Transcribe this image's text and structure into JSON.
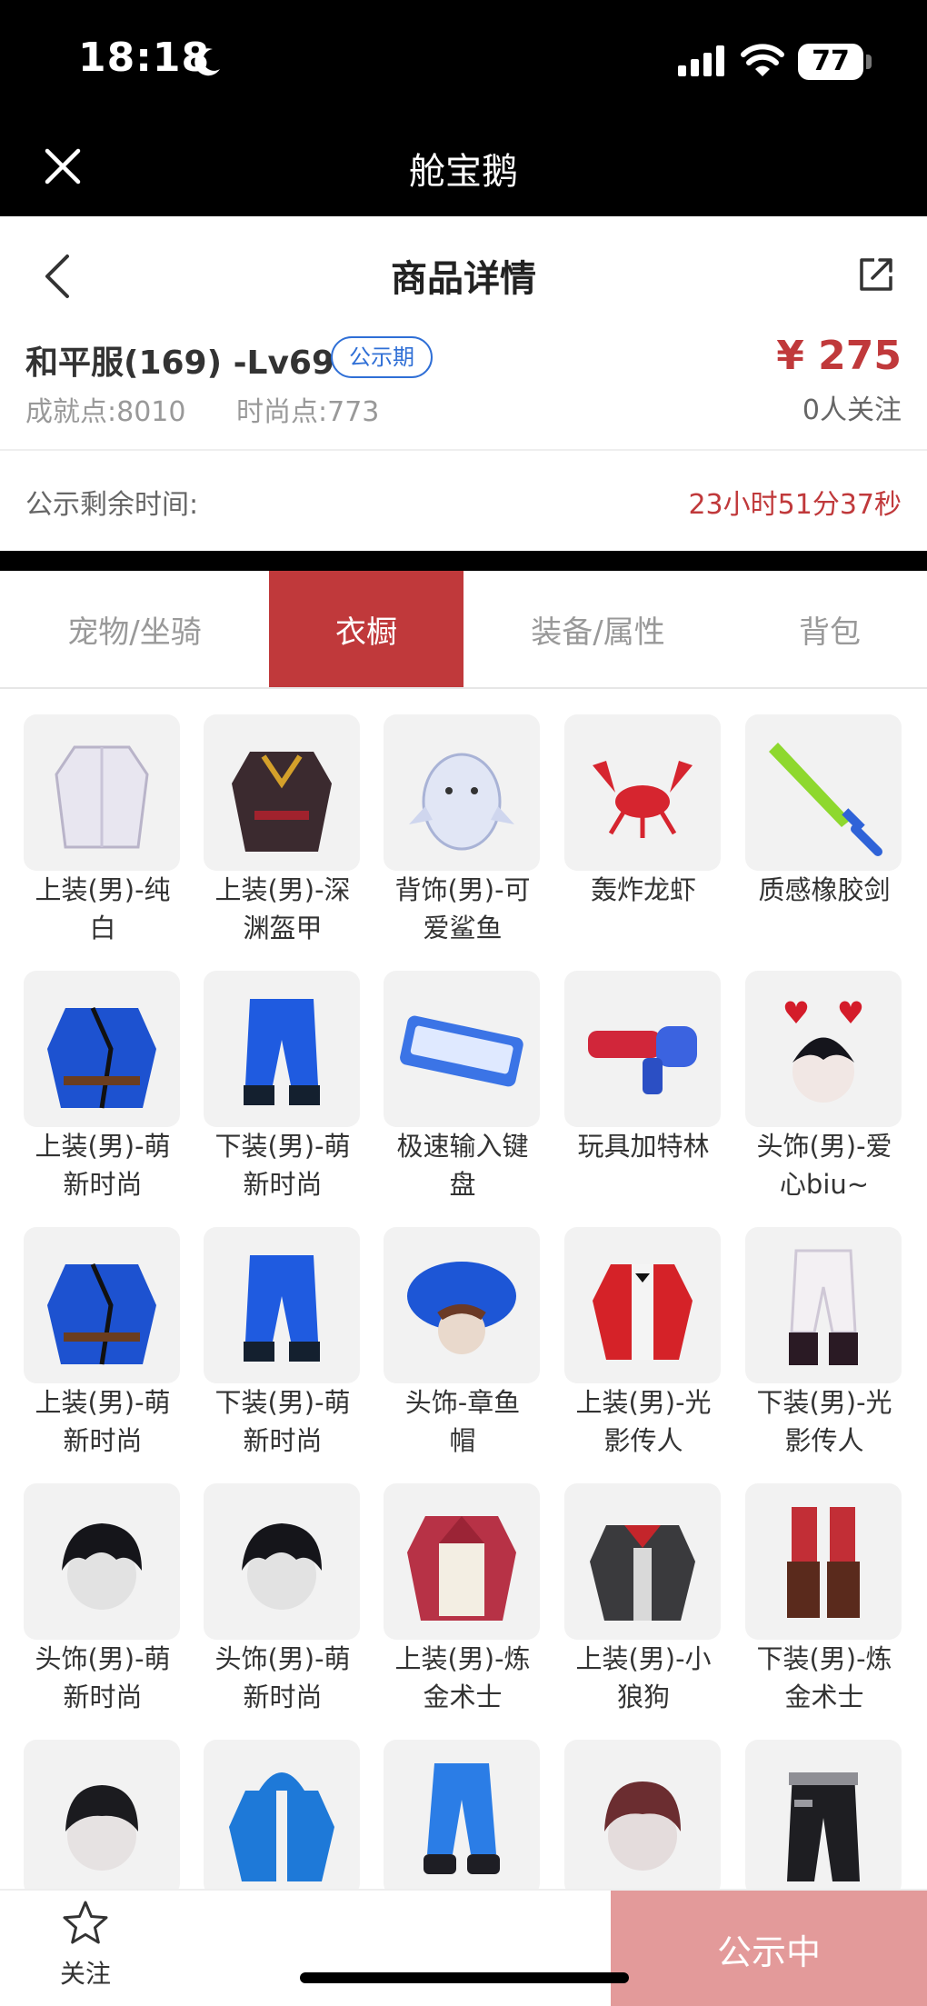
{
  "status_bar": {
    "time": "18:18",
    "battery": "77"
  },
  "app_bar": {
    "title": "舱宝鹅"
  },
  "header": {
    "title": "商品详情"
  },
  "product": {
    "server_level": "和平服(169) -Lv69",
    "badge": "公示期",
    "achievement_label": "成就点:",
    "achievement_value": "8010",
    "fashion_label": "时尚点:",
    "fashion_value": "773",
    "price": "¥ 275",
    "followers": "0人关注"
  },
  "countdown": {
    "label": "公示剩余时间:",
    "value": "23小时51分37秒"
  },
  "tabs": [
    {
      "label": "宠物/坐骑",
      "active": false
    },
    {
      "label": "衣橱",
      "active": true
    },
    {
      "label": "装备/属性",
      "active": false
    },
    {
      "label": "背包",
      "active": false
    }
  ],
  "items": [
    {
      "line1": "上装(男)-纯",
      "line2": "白",
      "icon": "white-coat-icon"
    },
    {
      "line1": "上装(男)-深",
      "line2": "渊盔甲",
      "icon": "dark-armor-icon"
    },
    {
      "line1": "背饰(男)-可",
      "line2": "爱鲨鱼",
      "icon": "shark-backpack-icon"
    },
    {
      "line1": "轰炸龙虾",
      "line2": "",
      "icon": "lobster-icon"
    },
    {
      "line1": "质感橡胶剑",
      "line2": "",
      "icon": "rubber-sword-icon"
    },
    {
      "line1": "上装(男)-萌",
      "line2": "新时尚",
      "icon": "blue-robe-icon"
    },
    {
      "line1": "下装(男)-萌",
      "line2": "新时尚",
      "icon": "blue-pants-icon"
    },
    {
      "line1": "极速输入键",
      "line2": "盘",
      "icon": "keyboard-icon"
    },
    {
      "line1": "玩具加特林",
      "line2": "",
      "icon": "toy-gatling-icon"
    },
    {
      "line1": "头饰(男)-爱",
      "line2": "心biu~",
      "icon": "heart-headband-icon"
    },
    {
      "line1": "上装(男)-萌",
      "line2": "新时尚",
      "icon": "blue-robe-icon"
    },
    {
      "line1": "下装(男)-萌",
      "line2": "新时尚",
      "icon": "blue-pants-icon"
    },
    {
      "line1": "头饰-章鱼",
      "line2": "帽",
      "icon": "octopus-hat-icon"
    },
    {
      "line1": "上装(男)-光",
      "line2": "影传人",
      "icon": "red-jacket-icon"
    },
    {
      "line1": "下装(男)-光",
      "line2": "影传人",
      "icon": "white-pants-icon"
    },
    {
      "line1": "头饰(男)-萌",
      "line2": "新时尚",
      "icon": "black-hair-icon"
    },
    {
      "line1": "头饰(男)-萌",
      "line2": "新时尚",
      "icon": "black-hair-icon"
    },
    {
      "line1": "上装(男)-炼",
      "line2": "金术士",
      "icon": "alchemist-coat-icon"
    },
    {
      "line1": "上装(男)-小",
      "line2": "狼狗",
      "icon": "wolf-jacket-icon"
    },
    {
      "line1": "下装(男)-炼",
      "line2": "金术士",
      "icon": "alchemist-boots-icon"
    },
    {
      "line1": "",
      "line2": "",
      "icon": "short-hair-icon"
    },
    {
      "line1": "",
      "line2": "",
      "icon": "blue-hoodie-icon"
    },
    {
      "line1": "",
      "line2": "",
      "icon": "blue-joggers-icon"
    },
    {
      "line1": "",
      "line2": "",
      "icon": "brown-hair-icon"
    },
    {
      "line1": "",
      "line2": "",
      "icon": "black-belt-pants-icon"
    }
  ],
  "bottom": {
    "follow": "关注",
    "status": "公示中"
  },
  "colors": {
    "accent": "#c0393b",
    "link": "#2f6fd6",
    "disabled_button": "#e39a9a"
  }
}
